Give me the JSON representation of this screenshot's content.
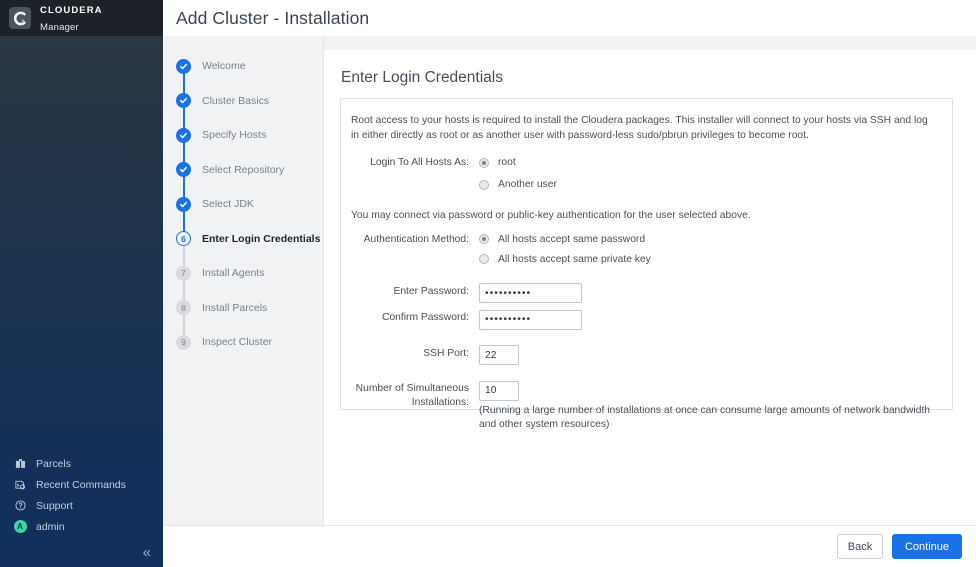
{
  "brand": {
    "name": "CLOUDERA",
    "sub": "Manager",
    "logo_icon": "cloudera-c-icon"
  },
  "header": {
    "title": "Add Cluster - Installation"
  },
  "wizard": {
    "steps": [
      {
        "num": "1",
        "label": "Welcome",
        "state": "done"
      },
      {
        "num": "2",
        "label": "Cluster Basics",
        "state": "done"
      },
      {
        "num": "3",
        "label": "Specify Hosts",
        "state": "done"
      },
      {
        "num": "4",
        "label": "Select Repository",
        "state": "done"
      },
      {
        "num": "5",
        "label": "Select JDK",
        "state": "done"
      },
      {
        "num": "6",
        "label": "Enter Login Credentials",
        "state": "current"
      },
      {
        "num": "7",
        "label": "Install Agents",
        "state": "todo"
      },
      {
        "num": "8",
        "label": "Install Parcels",
        "state": "todo"
      },
      {
        "num": "9",
        "label": "Inspect Cluster",
        "state": "todo"
      }
    ]
  },
  "main": {
    "title": "Enter Login Credentials",
    "intro": "Root access to your hosts is required to install the Cloudera packages. This installer will connect to your hosts via SSH and log in either directly as root or as another user with password-less sudo/pbrun privileges to become root.",
    "login_as_label": "Login To All Hosts As:",
    "login_as_options": [
      {
        "label": "root",
        "checked": true
      },
      {
        "label": "Another user",
        "checked": false
      }
    ],
    "auth_intro": "You may connect via password or public-key authentication for the user selected above.",
    "auth_method_label": "Authentication Method:",
    "auth_method_options": [
      {
        "label": "All hosts accept same password",
        "checked": true
      },
      {
        "label": "All hosts accept same private key",
        "checked": false
      }
    ],
    "enter_password_label": "Enter Password:",
    "enter_password_value": "••••••••••",
    "confirm_password_label": "Confirm Password:",
    "confirm_password_value": "••••••••••",
    "ssh_port_label": "SSH Port:",
    "ssh_port_value": "22",
    "simultaneous_label": "Number of Simultaneous Installations:",
    "simultaneous_value": "10",
    "simultaneous_hint": "(Running a large number of installations at once can consume large amounts of network bandwidth and other system resources)"
  },
  "leftnav": {
    "items": [
      {
        "label": "Parcels",
        "icon": "parcels-icon"
      },
      {
        "label": "Recent Commands",
        "icon": "recent-commands-icon"
      },
      {
        "label": "Support",
        "icon": "support-question-icon"
      },
      {
        "label": "admin",
        "icon": "user-avatar-icon",
        "avatar_letter": "A"
      }
    ],
    "collapse_glyph": "«"
  },
  "footer": {
    "back_label": "Back",
    "continue_label": "Continue"
  },
  "colors": {
    "accent_blue": "#1a72e8",
    "nav_dark_top": "#2e3841",
    "nav_dark_bottom": "#11305f",
    "avatar_green": "#3dd6a6",
    "panel_gray": "#f1f2f4"
  }
}
